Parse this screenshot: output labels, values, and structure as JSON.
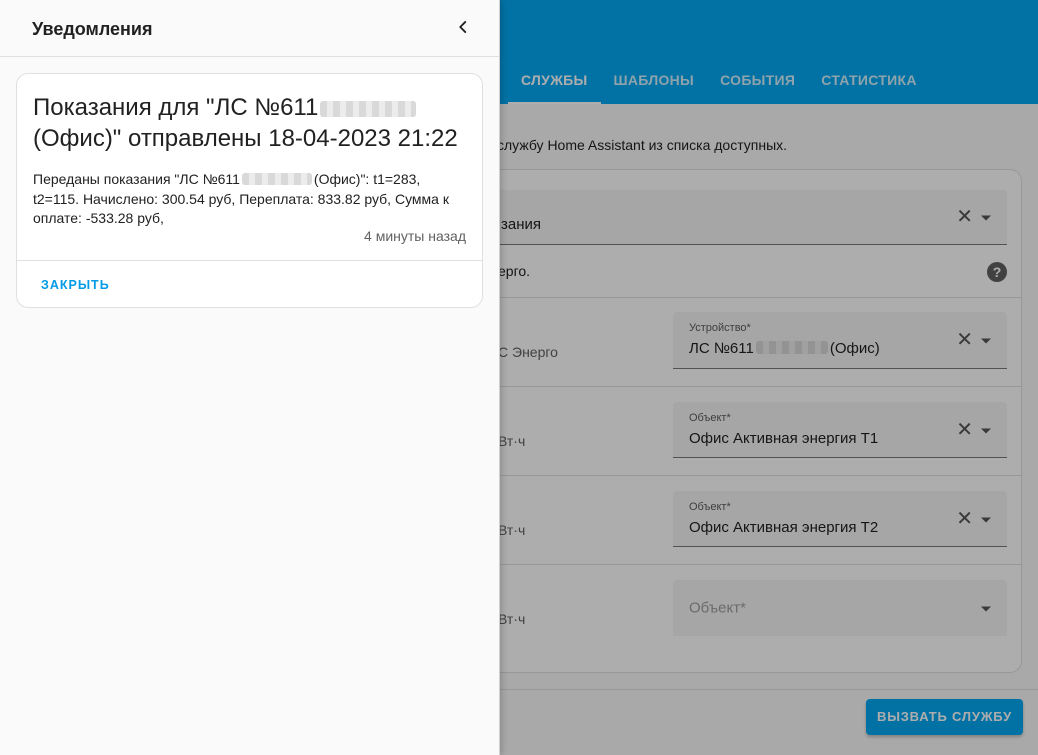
{
  "tabs": [
    {
      "label": "СЛУЖБЫ",
      "active": true
    },
    {
      "label": "ШАБЛОНЫ"
    },
    {
      "label": "СОБЫТИЯ"
    },
    {
      "label": "СТАТИСТИКА"
    }
  ],
  "service": {
    "description": "службу Home Assistant из списка доступных.",
    "service_value": "зания",
    "integration_text": "ерго.",
    "rows": [
      {
        "label": "С Энерго",
        "field_label": "Устройство*",
        "value_prefix": "ЛС №611",
        "value_suffix": "(Офис)"
      },
      {
        "label": "Вт·ч",
        "field_label": "Объект*",
        "value": "Офис Активная энергия Т1"
      },
      {
        "label": "Вт·ч",
        "field_label": "Объект*",
        "value": "Офис Активная энергия Т2"
      },
      {
        "label": "Вт·ч",
        "placeholder": "Объект*"
      }
    ],
    "call_button": "ВЫЗВАТЬ СЛУЖБУ"
  },
  "drawer": {
    "title": "Уведомления",
    "notification": {
      "title_line1_prefix": "Показания для \"ЛС №611",
      "title_line2": "(Офис)\" отправлены 18-04-2023 21:22",
      "message_prefix": "Переданы показания \"ЛС №611",
      "message_suffix": "(Офис)\": t1=283, t2=115. Начислено: 300.54 руб, Переплата: 833.82 руб, Сумма к оплате: -533.28 руб,",
      "time": "4 минуты назад",
      "close_label": "ЗАКРЫТЬ"
    }
  },
  "colors": {
    "primary": "#03a9f4",
    "link": "#039be5"
  }
}
